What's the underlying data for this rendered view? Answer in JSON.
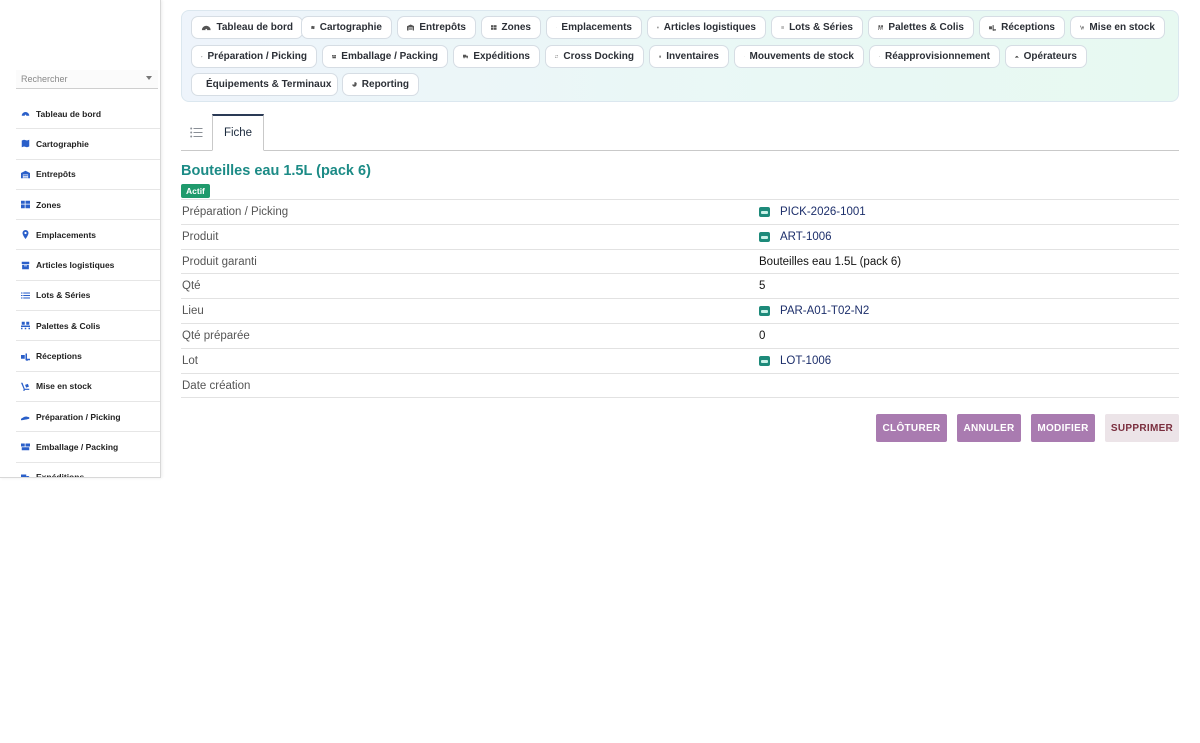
{
  "sidebar": {
    "search_placeholder": "Rechercher",
    "items": [
      {
        "label": "Tableau de bord",
        "icon": "dashboard-icon"
      },
      {
        "label": "Cartographie",
        "icon": "map-icon"
      },
      {
        "label": "Entrepôts",
        "icon": "warehouse-icon"
      },
      {
        "label": "Zones",
        "icon": "grid-icon"
      },
      {
        "label": "Emplacements",
        "icon": "map-pin-icon"
      },
      {
        "label": "Articles logistiques",
        "icon": "box-icon"
      },
      {
        "label": "Lots & Séries",
        "icon": "list-icon"
      },
      {
        "label": "Palettes & Colis",
        "icon": "pallet-icon"
      },
      {
        "label": "Réceptions",
        "icon": "truck-loading-icon"
      },
      {
        "label": "Mise en stock",
        "icon": "dolly-icon"
      },
      {
        "label": "Préparation / Picking",
        "icon": "hand-icon"
      },
      {
        "label": "Emballage / Packing",
        "icon": "boxes-icon"
      },
      {
        "label": "Expéditions",
        "icon": "shipping-icon"
      }
    ]
  },
  "topnav": {
    "items": [
      {
        "label": "Tableau de bord",
        "icon": "dashboard-icon"
      },
      {
        "label": "Cartographie",
        "icon": "map-icon"
      },
      {
        "label": "Entrepôts",
        "icon": "warehouse-icon"
      },
      {
        "label": "Zones",
        "icon": "grid-icon"
      },
      {
        "label": "Emplacements",
        "icon": "map-pin-icon"
      },
      {
        "label": "Articles logistiques",
        "icon": "box-icon"
      },
      {
        "label": "Lots & Séries",
        "icon": "list-icon"
      },
      {
        "label": "Palettes & Colis",
        "icon": "pallet-icon"
      },
      {
        "label": "Réceptions",
        "icon": "truck-loading-icon"
      },
      {
        "label": "Mise en stock",
        "icon": "dolly-icon"
      },
      {
        "label": "Préparation / Picking",
        "icon": "hand-icon"
      },
      {
        "label": "Emballage / Packing",
        "icon": "boxes-icon"
      },
      {
        "label": "Expéditions",
        "icon": "shipping-icon"
      },
      {
        "label": "Cross Docking",
        "icon": "exchange-icon"
      },
      {
        "label": "Inventaires",
        "icon": "clipboard-check-icon"
      },
      {
        "label": "Mouvements de stock",
        "icon": "shuffle-icon"
      },
      {
        "label": "Réapprovisionnement",
        "icon": "refresh-icon"
      },
      {
        "label": "Opérateurs",
        "icon": "hard-hat-icon"
      },
      {
        "label": "Équipements & Terminaux",
        "icon": "mobile-icon"
      },
      {
        "label": "Reporting",
        "icon": "pie-chart-icon"
      }
    ]
  },
  "tabs": {
    "list_icon": "list-view-icon",
    "active": "Fiche"
  },
  "record": {
    "title": "Bouteilles eau 1.5L (pack 6)",
    "status": "Actif",
    "fields": [
      {
        "label": "Préparation / Picking",
        "value": "PICK-2026-1001",
        "link": true
      },
      {
        "label": "Produit",
        "value": "ART-1006",
        "link": true
      },
      {
        "label": "Produit garanti",
        "value": "Bouteilles eau 1.5L (pack 6)",
        "link": false
      },
      {
        "label": "Qté",
        "value": "5",
        "link": false
      },
      {
        "label": "Lieu",
        "value": "PAR-A01-T02-N2",
        "link": true
      },
      {
        "label": "Qté préparée",
        "value": "0",
        "link": false
      },
      {
        "label": "Lot",
        "value": "LOT-1006",
        "link": true
      },
      {
        "label": "Date création",
        "value": "",
        "link": false
      }
    ]
  },
  "actions": {
    "close": "CLÔTURER",
    "cancel": "ANNULER",
    "edit": "MODIFIER",
    "delete": "SUPPRIMER"
  },
  "colors": {
    "accent_teal": "#1c8b86",
    "badge_green": "#1f9a6c",
    "action_purple": "#a97bb0",
    "delete_bg": "#ece4e8"
  }
}
